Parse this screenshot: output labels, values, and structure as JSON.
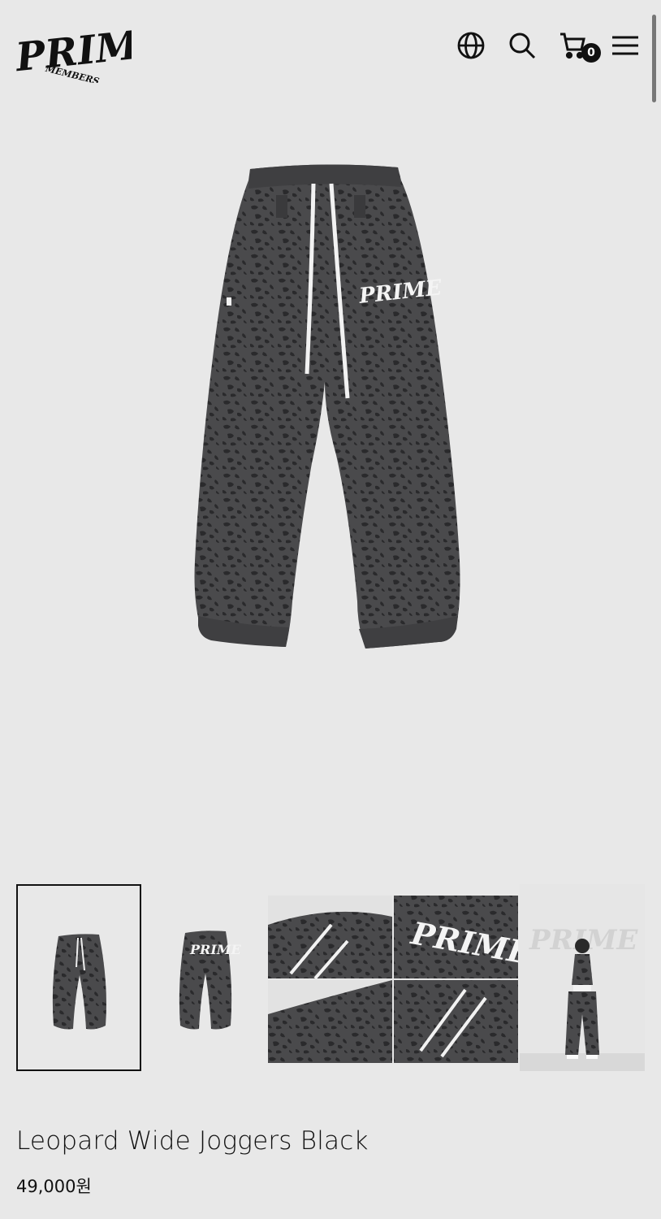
{
  "header": {
    "logo_main": "PRIME",
    "logo_sub": "MEMBERS",
    "cart_count": "0",
    "icons": [
      "globe-icon",
      "search-icon",
      "cart-icon",
      "menu-icon"
    ]
  },
  "product": {
    "title": "Leopard Wide Joggers Black",
    "price": "49,000원",
    "print_text": "PRIME",
    "thumbnails": [
      {
        "name": "thumb-front",
        "selected": true
      },
      {
        "name": "thumb-back",
        "selected": false
      },
      {
        "name": "thumb-details",
        "selected": false
      },
      {
        "name": "thumb-model",
        "selected": false
      }
    ]
  },
  "colors": {
    "background": "#e8e8e8",
    "fabric": "#4a4a4c",
    "spots": "#2b2b2d",
    "text": "#111111"
  }
}
